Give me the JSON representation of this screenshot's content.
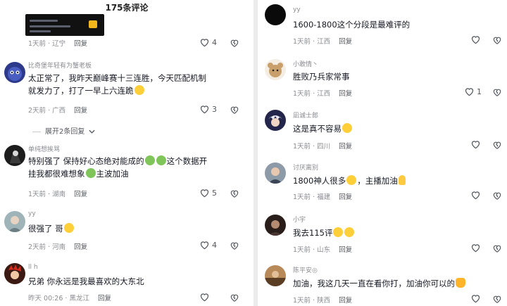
{
  "header": {
    "title": "175条评论"
  },
  "left": [
    {
      "name": "",
      "text": "",
      "time": "1天前",
      "loc": "辽宁",
      "reply": "回复",
      "likes": "4"
    },
    {
      "name": "比奇堡年轻有为蟹老板",
      "text": "太正常了，我昨天巅峰赛十三连胜，今天匹配机制就发力了，打了一早上六连跪",
      "emoji": [
        "sad"
      ],
      "time": "2天前",
      "loc": "广西",
      "reply": "回复",
      "likes": "3"
    },
    {
      "name": "单纯想挨骂",
      "text": "特别强了 保持好心态绝对能成的",
      "text2": "这个数据开挂我都很难想象",
      "text3": "主波加油",
      "time": "1天前",
      "loc": "湖南",
      "reply": "回复",
      "likes": "5"
    },
    {
      "name": "yy",
      "text": "很强了 哥",
      "time": "2天前",
      "loc": "河南",
      "reply": "回复",
      "likes": "4"
    },
    {
      "name": "ll h",
      "text": "兄弟 你永远是我最喜欢的大东北",
      "time": "昨天 00:26",
      "loc": "黑龙江",
      "reply": "回复",
      "likes": ""
    }
  ],
  "expand": {
    "label": "展开2条回复",
    "icon": "chevron-down-icon"
  },
  "right": [
    {
      "name": "yy",
      "text": "1600-1800这个分段是最难评的",
      "time": "1天前",
      "loc": "江西",
      "reply": "回复",
      "likes": ""
    },
    {
      "name": "小敢情丶",
      "text": "胜败乃兵家常事",
      "time": "1天前",
      "loc": "江西",
      "reply": "回复",
      "likes": "1"
    },
    {
      "name": "凪诚士郎",
      "text": "这是真不容易",
      "time": "1天前",
      "loc": "四川",
      "reply": "回复",
      "likes": ""
    },
    {
      "name": "讨厌离别",
      "text": "1800神人很多",
      "text2": "，主播加油",
      "time": "1天前",
      "loc": "福建",
      "reply": "回复",
      "likes": ""
    },
    {
      "name": "小宇",
      "text": "我去115评",
      "time": "1天前",
      "loc": "山东",
      "reply": "回复",
      "likes": ""
    },
    {
      "name": "陈平安◎",
      "text": "加油，我这几天一直在看你打，加油你可以的",
      "time": "1天前",
      "loc": "陕西",
      "reply": "回复",
      "likes": ""
    }
  ],
  "colors": {
    "text": "#161823",
    "muted": "#8a8b91",
    "icon": "#55575f"
  }
}
